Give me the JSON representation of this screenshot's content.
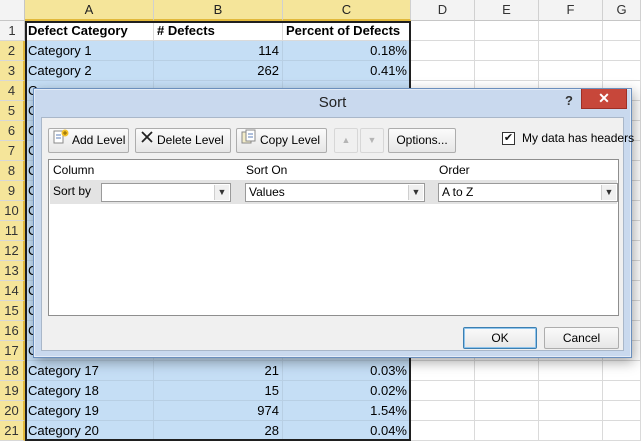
{
  "spreadsheet": {
    "columns": [
      "A",
      "B",
      "C",
      "D",
      "E",
      "F",
      "G"
    ],
    "header": [
      "Defect Category",
      "# Defects",
      "Percent of Defects"
    ],
    "rows": [
      {
        "n": "2",
        "a": "Category 1",
        "b": "114",
        "c": "0.18%"
      },
      {
        "n": "3",
        "a": "Category 2",
        "b": "262",
        "c": "0.41%"
      },
      {
        "n": "4",
        "a": "Ca",
        "b": "",
        "c": ""
      },
      {
        "n": "5",
        "a": "C",
        "b": "",
        "c": ""
      },
      {
        "n": "6",
        "a": "C",
        "b": "",
        "c": ""
      },
      {
        "n": "7",
        "a": "C",
        "b": "",
        "c": ""
      },
      {
        "n": "8",
        "a": "C",
        "b": "",
        "c": ""
      },
      {
        "n": "9",
        "a": "C",
        "b": "",
        "c": ""
      },
      {
        "n": "10",
        "a": "C",
        "b": "",
        "c": ""
      },
      {
        "n": "11",
        "a": "C",
        "b": "",
        "c": ""
      },
      {
        "n": "12",
        "a": "C",
        "b": "",
        "c": ""
      },
      {
        "n": "13",
        "a": "C",
        "b": "",
        "c": ""
      },
      {
        "n": "14",
        "a": "C",
        "b": "",
        "c": ""
      },
      {
        "n": "15",
        "a": "C",
        "b": "",
        "c": ""
      },
      {
        "n": "16",
        "a": "C",
        "b": "",
        "c": ""
      },
      {
        "n": "17",
        "a": "C",
        "b": "",
        "c": ""
      },
      {
        "n": "18",
        "a": "Category 17",
        "b": "21",
        "c": "0.03%"
      },
      {
        "n": "19",
        "a": "Category 18",
        "b": "15",
        "c": "0.02%"
      },
      {
        "n": "20",
        "a": "Category 19",
        "b": "974",
        "c": "1.54%"
      },
      {
        "n": "21",
        "a": "Category 20",
        "b": "28",
        "c": "0.04%"
      }
    ],
    "header_row_num": "1"
  },
  "dialog": {
    "title": "Sort",
    "help": "?",
    "close": "✕",
    "toolbar": {
      "add_level": "Add Level",
      "delete_level": "Delete Level",
      "copy_level": "Copy Level",
      "move_up": "▲",
      "move_down": "▼",
      "options": "Options...",
      "headers_checkbox_label": "My data has headers",
      "headers_checked": "✔"
    },
    "list": {
      "col_header_column": "Column",
      "col_header_sort_on": "Sort On",
      "col_header_order": "Order",
      "row_label": "Sort by",
      "column_value": "",
      "sort_on_value": "Values",
      "order_value": "A to Z",
      "dropdown_glyph": "▼"
    },
    "ok": "OK",
    "cancel": "Cancel"
  },
  "colors": {
    "selection_fill": "#c5def5",
    "header_selected": "#f5e59a",
    "close_button": "#c7473a",
    "dialog_frame": "#c9d9ee"
  }
}
